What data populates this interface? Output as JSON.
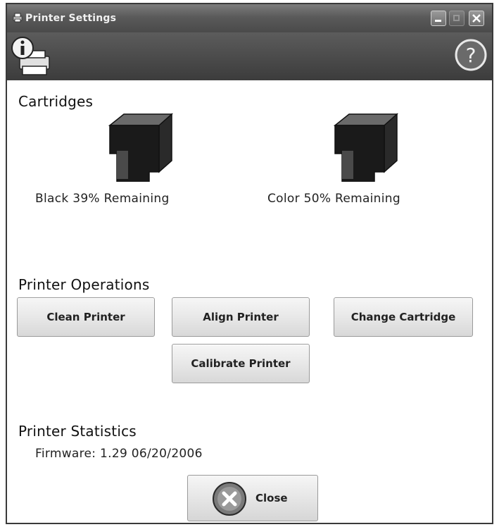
{
  "window": {
    "title": "Printer Settings"
  },
  "cartridges": {
    "heading": "Cartridges",
    "black": {
      "label": "Black 39%  Remaining",
      "remaining_percent": 39
    },
    "color": {
      "label": "Color 50% Remaining",
      "remaining_percent": 50
    }
  },
  "operations": {
    "heading": "Printer Operations",
    "clean": "Clean Printer",
    "align": "Align Printer",
    "change": "Change Cartridge",
    "calibrate": "Calibrate Printer"
  },
  "statistics": {
    "heading": "Printer Statistics",
    "firmware": "Firmware: 1.29 06/20/2006"
  },
  "footer": {
    "close_label": "Close"
  },
  "icons": {
    "title": "printer-settings-icon",
    "info": "printer-info-icon",
    "help": "help-icon",
    "close": "close-x-icon",
    "cartridge": "ink-cartridge-icon"
  }
}
